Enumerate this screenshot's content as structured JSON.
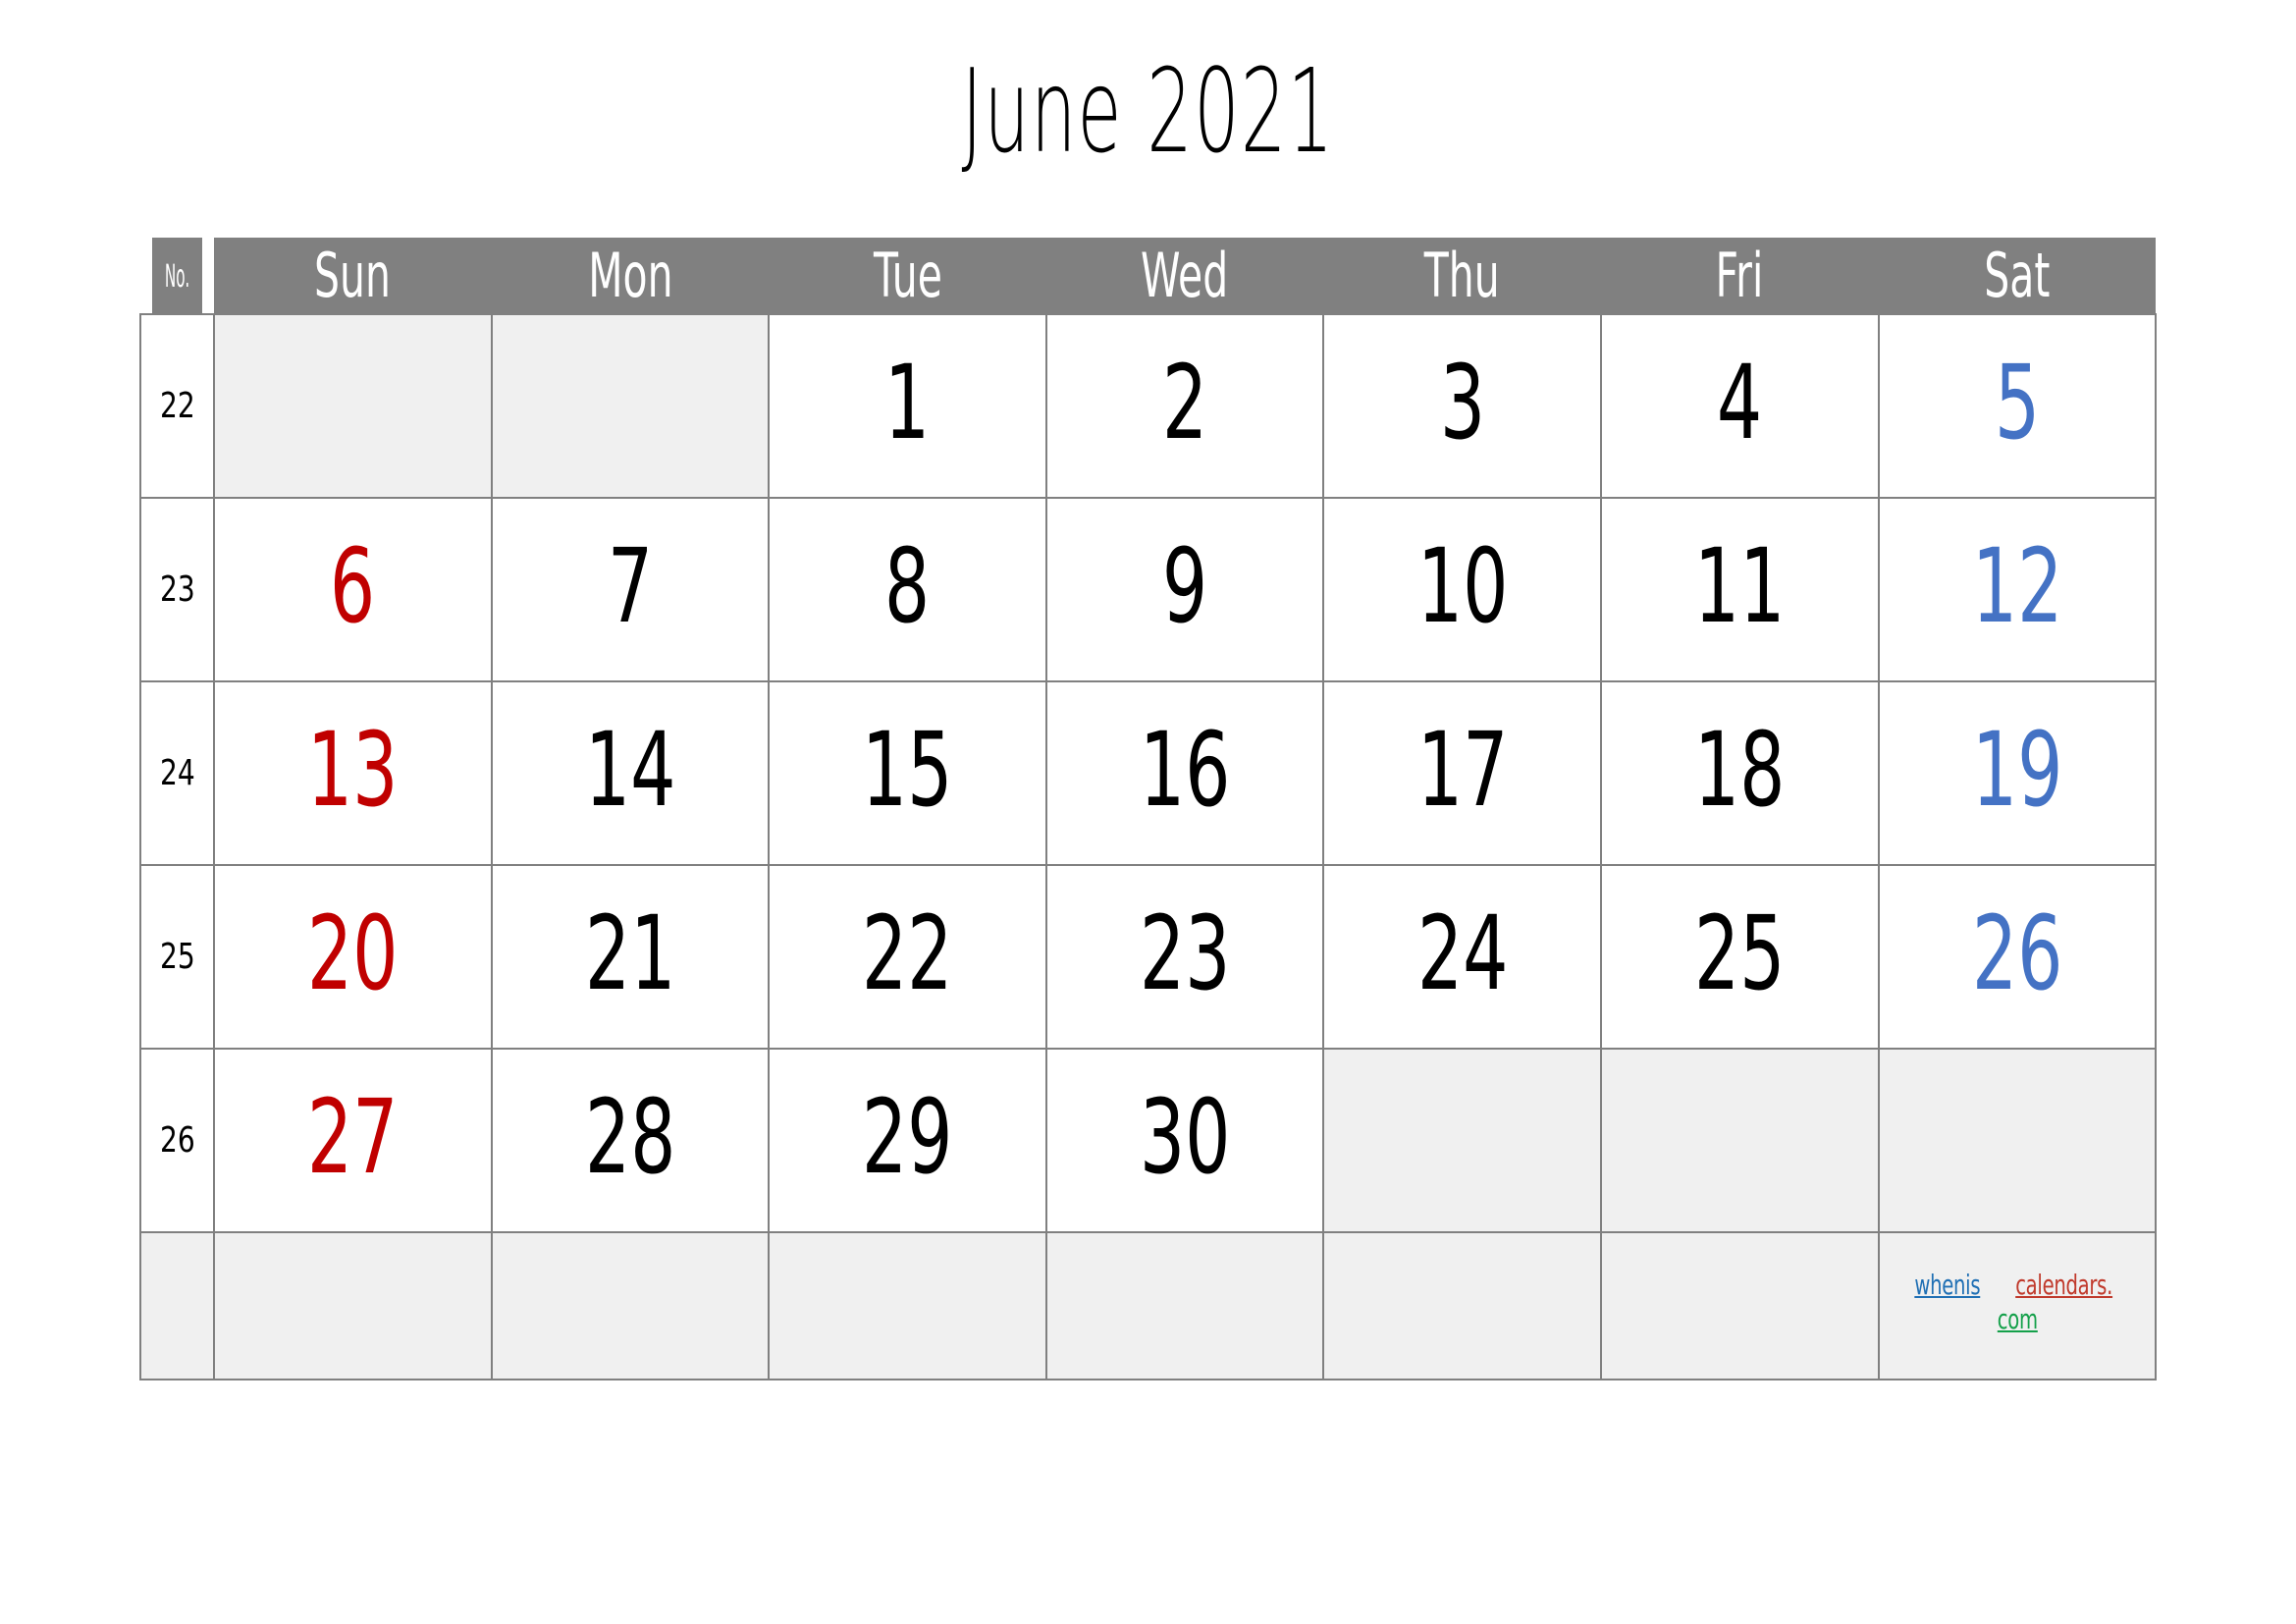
{
  "title": "June 2021",
  "header": {
    "week_no_label": "No.",
    "days": [
      "Sun",
      "Mon",
      "Tue",
      "Wed",
      "Thu",
      "Fri",
      "Sat"
    ]
  },
  "colors": {
    "header_bg": "#808080",
    "header_text": "#ffffff",
    "grid_line": "#808080",
    "empty_cell_bg": "#f0f0f0",
    "sunday": "#C00000",
    "saturday": "#4472C4",
    "weekday": "#000000",
    "watermark_blue": "#1F6FB4",
    "watermark_red": "#C0392B",
    "watermark_green": "#14A04A"
  },
  "weeks": [
    {
      "no": "22",
      "days": [
        {
          "text": "",
          "empty": true,
          "kind": "sun"
        },
        {
          "text": "",
          "empty": true,
          "kind": "weekday"
        },
        {
          "text": "1",
          "empty": false,
          "kind": "weekday"
        },
        {
          "text": "2",
          "empty": false,
          "kind": "weekday"
        },
        {
          "text": "3",
          "empty": false,
          "kind": "weekday"
        },
        {
          "text": "4",
          "empty": false,
          "kind": "weekday"
        },
        {
          "text": "5",
          "empty": false,
          "kind": "sat"
        }
      ]
    },
    {
      "no": "23",
      "days": [
        {
          "text": "6",
          "empty": false,
          "kind": "sun"
        },
        {
          "text": "7",
          "empty": false,
          "kind": "weekday"
        },
        {
          "text": "8",
          "empty": false,
          "kind": "weekday"
        },
        {
          "text": "9",
          "empty": false,
          "kind": "weekday"
        },
        {
          "text": "10",
          "empty": false,
          "kind": "weekday"
        },
        {
          "text": "11",
          "empty": false,
          "kind": "weekday"
        },
        {
          "text": "12",
          "empty": false,
          "kind": "sat"
        }
      ]
    },
    {
      "no": "24",
      "days": [
        {
          "text": "13",
          "empty": false,
          "kind": "sun"
        },
        {
          "text": "14",
          "empty": false,
          "kind": "weekday"
        },
        {
          "text": "15",
          "empty": false,
          "kind": "weekday"
        },
        {
          "text": "16",
          "empty": false,
          "kind": "weekday"
        },
        {
          "text": "17",
          "empty": false,
          "kind": "weekday"
        },
        {
          "text": "18",
          "empty": false,
          "kind": "weekday"
        },
        {
          "text": "19",
          "empty": false,
          "kind": "sat"
        }
      ]
    },
    {
      "no": "25",
      "days": [
        {
          "text": "20",
          "empty": false,
          "kind": "sun"
        },
        {
          "text": "21",
          "empty": false,
          "kind": "weekday"
        },
        {
          "text": "22",
          "empty": false,
          "kind": "weekday"
        },
        {
          "text": "23",
          "empty": false,
          "kind": "weekday"
        },
        {
          "text": "24",
          "empty": false,
          "kind": "weekday"
        },
        {
          "text": "25",
          "empty": false,
          "kind": "weekday"
        },
        {
          "text": "26",
          "empty": false,
          "kind": "sat"
        }
      ]
    },
    {
      "no": "26",
      "days": [
        {
          "text": "27",
          "empty": false,
          "kind": "sun"
        },
        {
          "text": "28",
          "empty": false,
          "kind": "weekday"
        },
        {
          "text": "29",
          "empty": false,
          "kind": "weekday"
        },
        {
          "text": "30",
          "empty": false,
          "kind": "weekday"
        },
        {
          "text": "",
          "empty": true,
          "kind": "weekday"
        },
        {
          "text": "",
          "empty": true,
          "kind": "weekday"
        },
        {
          "text": "",
          "empty": true,
          "kind": "sat"
        }
      ]
    },
    {
      "no": "",
      "days": [
        {
          "text": "",
          "empty": true,
          "kind": "sun"
        },
        {
          "text": "",
          "empty": true,
          "kind": "weekday"
        },
        {
          "text": "",
          "empty": true,
          "kind": "weekday"
        },
        {
          "text": "",
          "empty": true,
          "kind": "weekday"
        },
        {
          "text": "",
          "empty": true,
          "kind": "weekday"
        },
        {
          "text": "",
          "empty": true,
          "kind": "weekday"
        },
        {
          "text": "",
          "empty": true,
          "kind": "sat"
        }
      ]
    }
  ],
  "watermark": {
    "part1": "whenis",
    "part2": "calendars.",
    "part3": "com",
    "full": "wheniscalendars.com"
  }
}
